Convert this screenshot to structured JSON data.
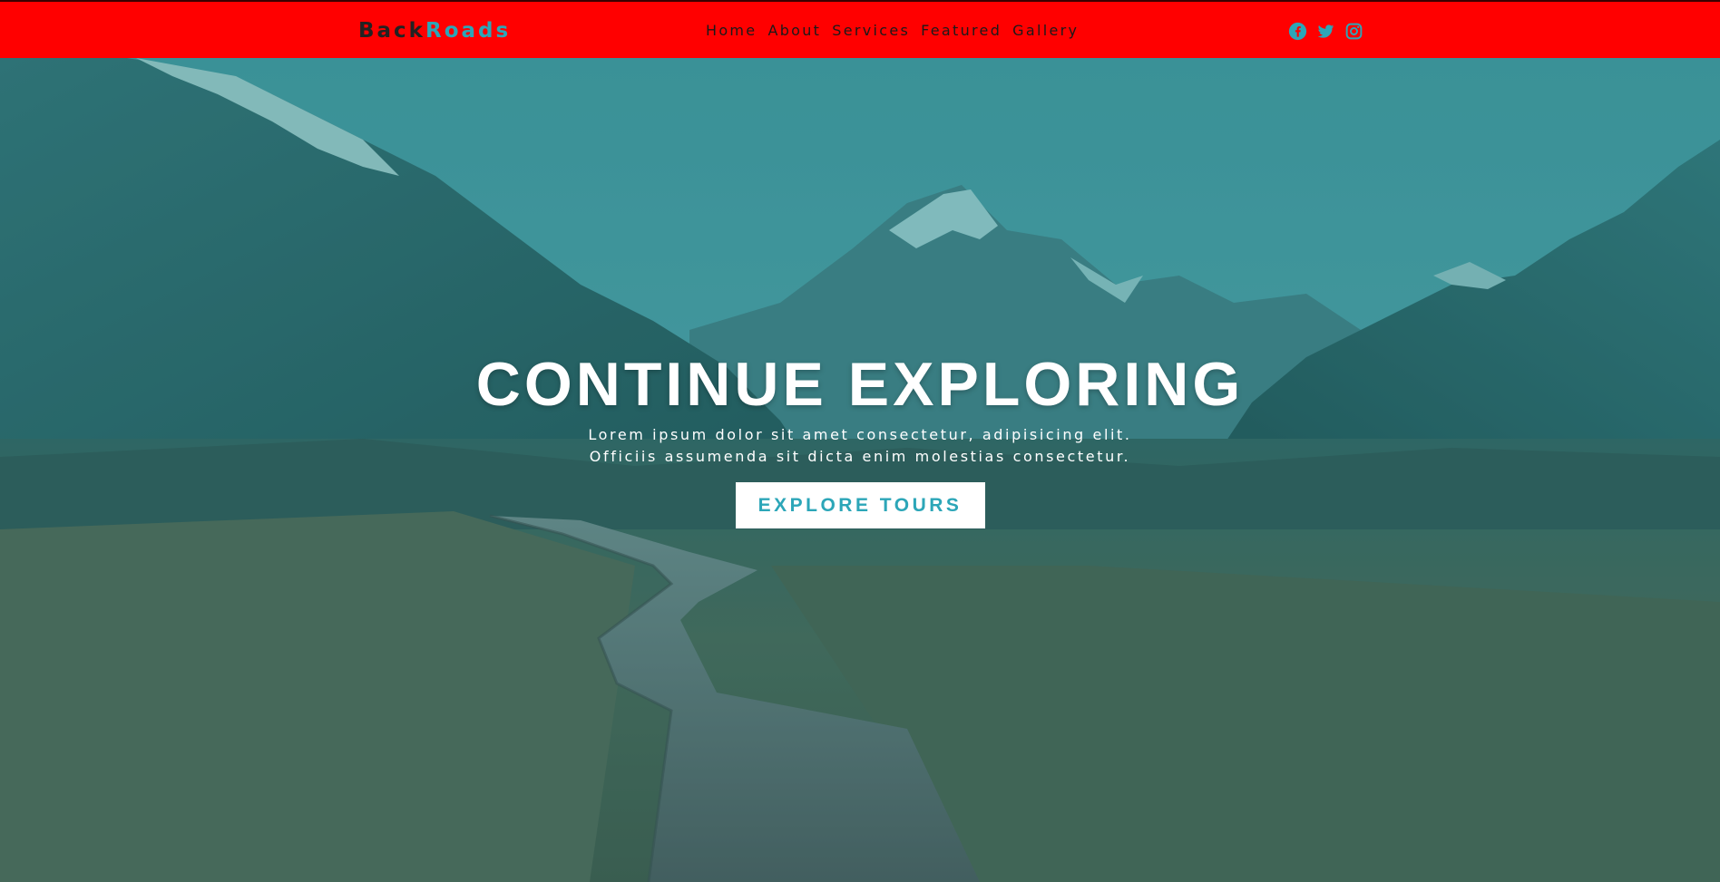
{
  "brand": {
    "part1": "Back",
    "part2": "Roads"
  },
  "nav": {
    "links": [
      {
        "label": "Home"
      },
      {
        "label": "About"
      },
      {
        "label": "Services"
      },
      {
        "label": "Featured"
      },
      {
        "label": "Gallery"
      }
    ],
    "social": [
      {
        "icon": "facebook-icon"
      },
      {
        "icon": "twitter-icon"
      },
      {
        "icon": "instagram-icon"
      }
    ]
  },
  "hero": {
    "title": "CONTINUE EXPLORING",
    "line1": "Lorem ipsum dolor sit amet consectetur, adipisicing elit.",
    "line2": "Officiis assumenda sit dicta enim molestias consectetur.",
    "button": "EXPLORE TOURS"
  },
  "colors": {
    "navbar": "#ff0000",
    "accent": "#2ca6b8",
    "logo_dark": "#222222",
    "button_bg": "#ffffff"
  }
}
